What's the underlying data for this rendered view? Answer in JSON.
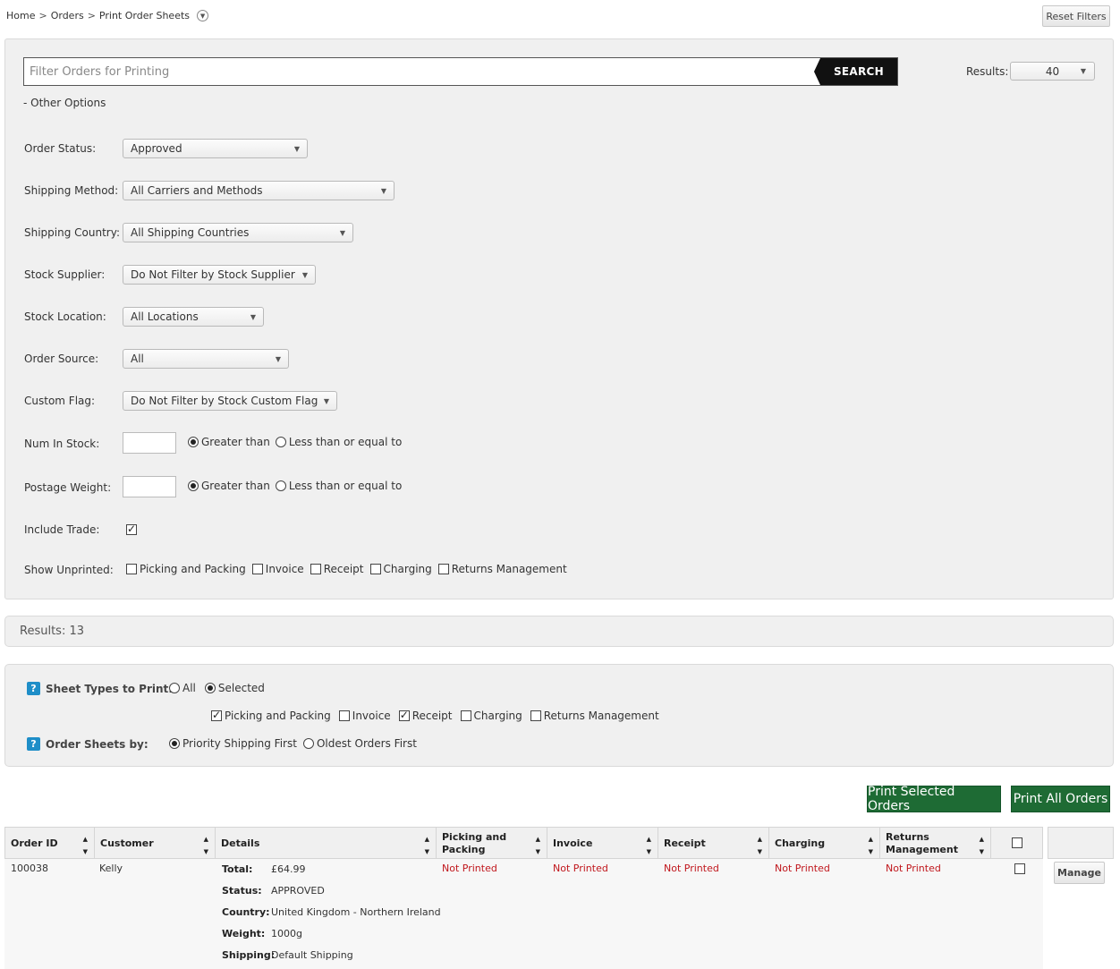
{
  "breadcrumb": {
    "items": [
      "Home",
      "Orders",
      "Print Order Sheets"
    ],
    "separator": ">"
  },
  "reset_filters_label": "Reset Filters",
  "search": {
    "placeholder": "Filter Orders for Printing",
    "value": "",
    "button_label": "SEARCH"
  },
  "results_select": {
    "label": "Results:",
    "value": "40"
  },
  "other_options_label": "- Other Options",
  "filters": {
    "order_status": {
      "label": "Order Status:",
      "value": "Approved"
    },
    "shipping_method": {
      "label": "Shipping Method:",
      "value": "All Carriers and Methods"
    },
    "shipping_country": {
      "label": "Shipping Country:",
      "value": "All Shipping Countries"
    },
    "stock_supplier": {
      "label": "Stock Supplier:",
      "value": "Do Not Filter by Stock Supplier"
    },
    "stock_location": {
      "label": "Stock Location:",
      "value": "All Locations"
    },
    "order_source": {
      "label": "Order Source:",
      "value": "All"
    },
    "custom_flag": {
      "label": "Custom Flag:",
      "value": "Do Not Filter by Stock Custom Flag"
    },
    "num_in_stock": {
      "label": "Num In Stock:",
      "value": "",
      "opt_greater": "Greater than",
      "opt_less": "Less than or equal to",
      "selected": "greater"
    },
    "postage_weight": {
      "label": "Postage Weight:",
      "value": "",
      "opt_greater": "Greater than",
      "opt_less": "Less than or equal to",
      "selected": "greater"
    },
    "include_trade": {
      "label": "Include Trade:",
      "checked": true
    },
    "show_unprinted": {
      "label": "Show Unprinted:",
      "options": [
        "Picking and Packing",
        "Invoice",
        "Receipt",
        "Charging",
        "Returns Management"
      ]
    }
  },
  "results_bar": "Results: 13",
  "print_options": {
    "sheet_types_label": "Sheet Types to Print:",
    "opt_all": "All",
    "opt_selected": "Selected",
    "sheet_types": [
      "Picking and Packing",
      "Invoice",
      "Receipt",
      "Charging",
      "Returns Management"
    ],
    "sheet_types_checked": [
      true,
      false,
      true,
      false,
      false
    ],
    "order_by_label": "Order Sheets by:",
    "opt_priority": "Priority Shipping First",
    "opt_oldest": "Oldest Orders First"
  },
  "actions": {
    "print_selected": "Print Selected Orders",
    "print_all": "Print All Orders"
  },
  "table": {
    "headers": {
      "order_id": "Order ID",
      "customer": "Customer",
      "details": "Details",
      "picking_1": "Picking and",
      "picking_2": "Packing",
      "invoice": "Invoice",
      "receipt": "Receipt",
      "charging": "Charging",
      "returns_1": "Returns",
      "returns_2": "Management"
    },
    "rows": [
      {
        "order_id": "100038",
        "customer": "Kelly",
        "details": {
          "total_label": "Total:",
          "total": "£64.99",
          "status_label": "Status:",
          "status": "APPROVED",
          "country_label": "Country:",
          "country": "United Kingdom - Northern Ireland",
          "weight_label": "Weight:",
          "weight": "1000g",
          "shipping_label": "Shipping:",
          "shipping": "Default Shipping"
        },
        "picking": "Not Printed",
        "invoice": "Not Printed",
        "receipt": "Not Printed",
        "charging": "Not Printed",
        "returns": "Not Printed",
        "manage_label": "Manage"
      }
    ]
  },
  "colors": {
    "green": "#1e6b34",
    "red": "#c0161c",
    "help_blue": "#1e8ec8"
  }
}
